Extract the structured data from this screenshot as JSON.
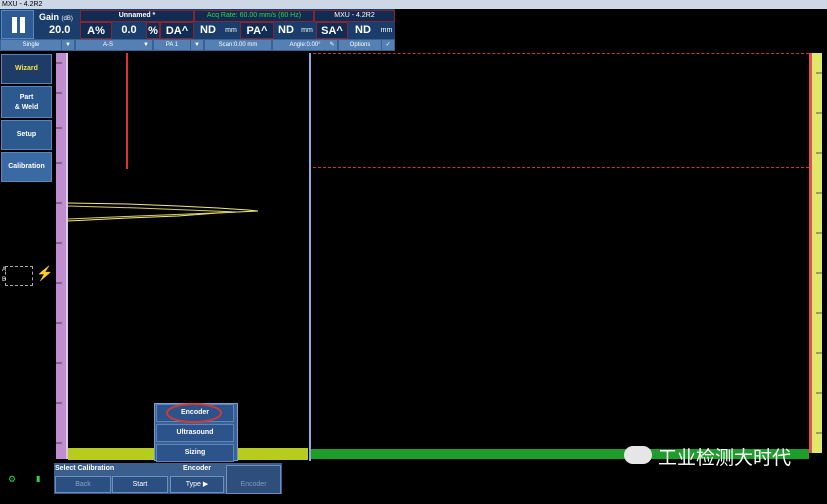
{
  "window": {
    "title": "MXU - 4.2R2"
  },
  "header": {
    "gain_label": "Gain",
    "gain_unit": "(dB)",
    "gain_value": "20.0",
    "file_name": "Unnamed *",
    "acq_rate": "Acq Rate: 60.00 mm/s (60 Hz)",
    "app_version": "MXU - 4.2R2",
    "a_pct_label": "A%",
    "a_pct_value": "0.0",
    "pct_unit": "%",
    "da_label": "DA^",
    "da_value": "ND",
    "da_unit": "mm",
    "pa_label": "PA^",
    "pa_value": "ND",
    "pa_unit": "mm",
    "sa_label": "SA^",
    "sa_value": "ND",
    "sa_unit": "mm"
  },
  "toolbar2": {
    "mode": "Single",
    "view": "A-S",
    "probe": "PA 1",
    "scan": "Scan:0.00 mm",
    "angle": "Angle:0.00°",
    "options": "Options"
  },
  "sidebar": {
    "items": [
      {
        "label": "Wizard"
      },
      {
        "label": "Part"
      },
      {
        "label": "& Weld"
      },
      {
        "label": "Setup"
      },
      {
        "label": "Calibration"
      }
    ]
  },
  "indicators": {
    "a": "A",
    "b": "B"
  },
  "popup": {
    "items": [
      {
        "label": "Encoder"
      },
      {
        "label": "Ultrasound"
      },
      {
        "label": "Sizing"
      }
    ]
  },
  "bottom": {
    "title": "Select Calibration",
    "back": "Back",
    "start": "Start",
    "encoder_header": "Encoder",
    "type": "Type",
    "encoder_btn": "Encoder"
  },
  "watermark": {
    "text": "工业检测大时代"
  },
  "colors": {
    "accent": "#2d5a8e",
    "gate_red": "#e03030",
    "signal_yellow": "#f2ea7a"
  }
}
